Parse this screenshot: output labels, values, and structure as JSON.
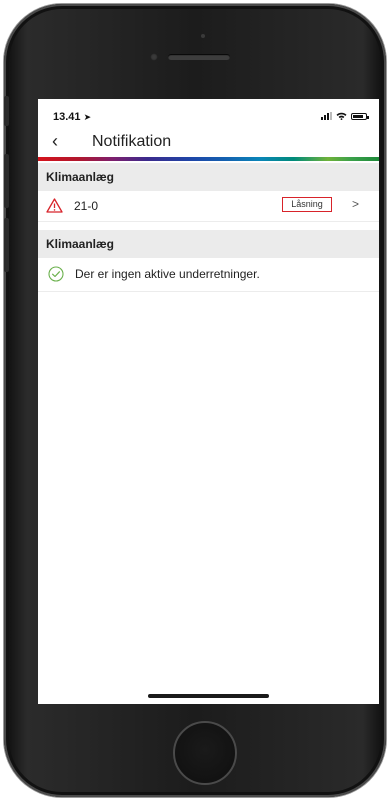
{
  "status_bar": {
    "time": "13.41",
    "location_arrow": "➤"
  },
  "nav": {
    "back_icon": "‹",
    "title": "Notifikation"
  },
  "sections": [
    {
      "header": "Klimaanlæg",
      "item": {
        "icon": "warning-triangle-icon",
        "code": "21-0",
        "tag": "Låsning",
        "chevron": ">"
      }
    },
    {
      "header": "Klimaanlæg",
      "item": {
        "icon": "check-circle-icon",
        "message": "Der er ingen aktive underretninger."
      }
    }
  ],
  "colors": {
    "warning": "#d8232a",
    "ok": "#6ab04c",
    "section_bg": "#ebebeb"
  }
}
